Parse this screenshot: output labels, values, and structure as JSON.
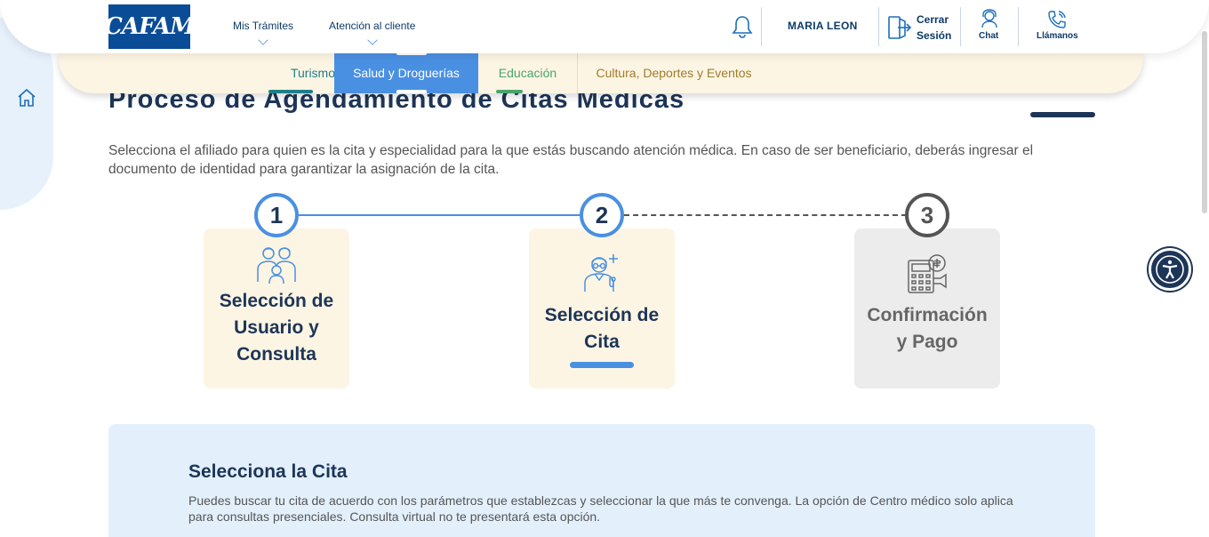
{
  "header": {
    "logo_text": "CAFAM",
    "nav": [
      {
        "label": "Mis Trámites"
      },
      {
        "label": "Atención al cliente"
      }
    ],
    "user_name": "MARIA LEON",
    "logout_line1": "Cerrar",
    "logout_line2": "Sesión",
    "chat_label": "Chat",
    "call_label": "Llámanos"
  },
  "categories": [
    {
      "label": "Turismo"
    },
    {
      "label": "Salud y Droguerías"
    },
    {
      "label": "Educación"
    },
    {
      "label": "Cultura, Deportes y Eventos"
    }
  ],
  "page": {
    "title": "Proceso de Agendamiento de Citas Médicas",
    "intro": "Selecciona el afiliado para quien es la cita y especialidad para la que estás buscando atención médica. En caso de ser beneficiario, deberás ingresar el documento de identidad para garantizar la asignación de la cita."
  },
  "steps": [
    {
      "number": "1",
      "label_l1": "Selección de",
      "label_l2": "Usuario y",
      "label_l3": "Consulta",
      "state": "completed"
    },
    {
      "number": "2",
      "label_l1": "Selección de",
      "label_l2": "Cita",
      "state": "active"
    },
    {
      "number": "3",
      "label_l1": "Confirmación",
      "label_l2": "y Pago",
      "state": "pending"
    }
  ],
  "select_panel": {
    "title": "Selecciona la Cita",
    "description": "Puedes buscar tu cita de acuerdo con los parámetros que establezcas y seleccionar la que más te convenga. La opción de Centro médico solo aplica para consultas presenciales. Consulta virtual no te presentará esta opción."
  },
  "colors": {
    "primary": "#1d3557",
    "accent": "#4a90e2",
    "brand": "#0b4c97",
    "cream": "#fdf5e4",
    "panel": "#e3f0fc"
  },
  "icons": [
    "home-icon",
    "bell-icon",
    "logout-icon",
    "chat-icon",
    "phone-icon",
    "family-icon",
    "doctor-icon",
    "payment-icon",
    "accessibility-icon"
  ]
}
